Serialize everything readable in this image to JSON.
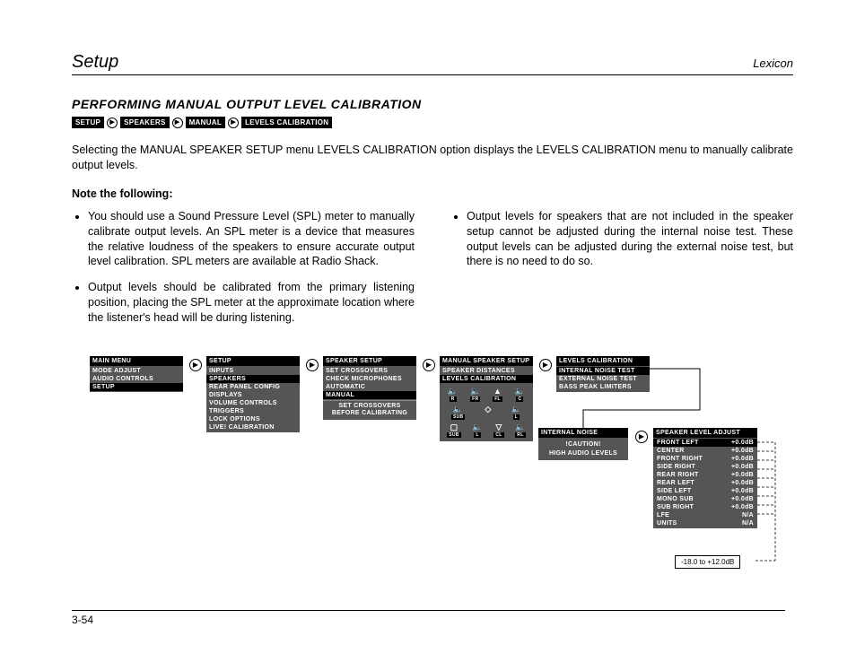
{
  "header": {
    "section": "Setup",
    "brand": "Lexicon"
  },
  "title": "PERFORMING MANUAL OUTPUT LEVEL CALIBRATION",
  "breadcrumb": [
    "SETUP",
    "SPEAKERS",
    "MANUAL",
    "LEVELS CALIBRATION"
  ],
  "intro": "Selecting the MANUAL SPEAKER SETUP menu LEVELS CALIBRATION option displays the LEVELS CALIBRATION menu to manually calibrate output levels.",
  "note_heading": "Note the following:",
  "left_bullets": [
    "You should use a Sound Pressure Level (SPL) meter to manually calibrate output levels. An SPL meter is a device that measures the relative loudness of the speakers to ensure accurate output level calibration. SPL meters are available at Radio Shack.",
    "Output levels should be calibrated from the primary listening position, placing the SPL meter at the approximate location where the listener's head will be during listening."
  ],
  "right_bullets": [
    "Output levels for speakers that are not included in the speaker setup cannot be adjusted during the internal noise test. These output levels can be adjusted during the external noise test, but there is no need to do so."
  ],
  "menus": {
    "main": {
      "title": "MAIN MENU",
      "items": [
        "MODE ADJUST",
        "AUDIO CONTROLS",
        "SETUP"
      ],
      "sel": "SETUP"
    },
    "setup": {
      "title": "SETUP",
      "items": [
        "INPUTS",
        "SPEAKERS",
        "REAR PANEL CONFIG",
        "DISPLAYS",
        "VOLUME CONTROLS",
        "TRIGGERS",
        "LOCK OPTIONS",
        "LIVE! CALIBRATION"
      ],
      "sel": "SPEAKERS"
    },
    "speaker": {
      "title": "SPEAKER SETUP",
      "items": [
        "SET CROSSOVERS",
        "CHECK MICROPHONES",
        "AUTOMATIC",
        "MANUAL"
      ],
      "sel": "MANUAL",
      "footer": "SET CROSSOVERS\nBEFORE CALIBRATING"
    },
    "manual": {
      "title": "MANUAL SPEAKER SETUP",
      "items": [
        "SPEAKER DISTANCES",
        "LEVELS CALIBRATION"
      ],
      "sel": "LEVELS CALIBRATION"
    },
    "levels": {
      "title": "LEVELS CALIBRATION",
      "items": [
        "INTERNAL NOISE TEST",
        "EXTERNAL NOISE TEST",
        "BASS PEAK LIMITERS"
      ],
      "sel": "INTERNAL NOISE TEST"
    },
    "caution": {
      "title": "INTERNAL NOISE",
      "l1": "!CAUTION!",
      "l2": "HIGH AUDIO LEVELS"
    },
    "adjust": {
      "title": "SPEAKER LEVEL ADJUST",
      "rows": [
        {
          "n": "FRONT LEFT",
          "v": "+0.0dB"
        },
        {
          "n": "CENTER",
          "v": "+0.0dB"
        },
        {
          "n": "FRONT RIGHT",
          "v": "+0.0dB"
        },
        {
          "n": "SIDE RIGHT",
          "v": "+0.0dB"
        },
        {
          "n": "REAR RIGHT",
          "v": "+0.0dB"
        },
        {
          "n": "REAR LEFT",
          "v": "+0.0dB"
        },
        {
          "n": "SIDE LEFT",
          "v": "+0.0dB"
        },
        {
          "n": "MONO SUB",
          "v": "+0.0dB"
        },
        {
          "n": "SUB RIGHT",
          "v": "+0.0dB"
        },
        {
          "n": "LFE",
          "v": "N/A"
        },
        {
          "n": "UNITS",
          "v": "N/A"
        }
      ]
    },
    "range": "-18.0 to +12.0dB",
    "icon_labels": [
      "R",
      "FR",
      "FL",
      "C",
      "SUB",
      "L",
      "CL",
      "RL"
    ]
  },
  "pagenum": "3-54"
}
